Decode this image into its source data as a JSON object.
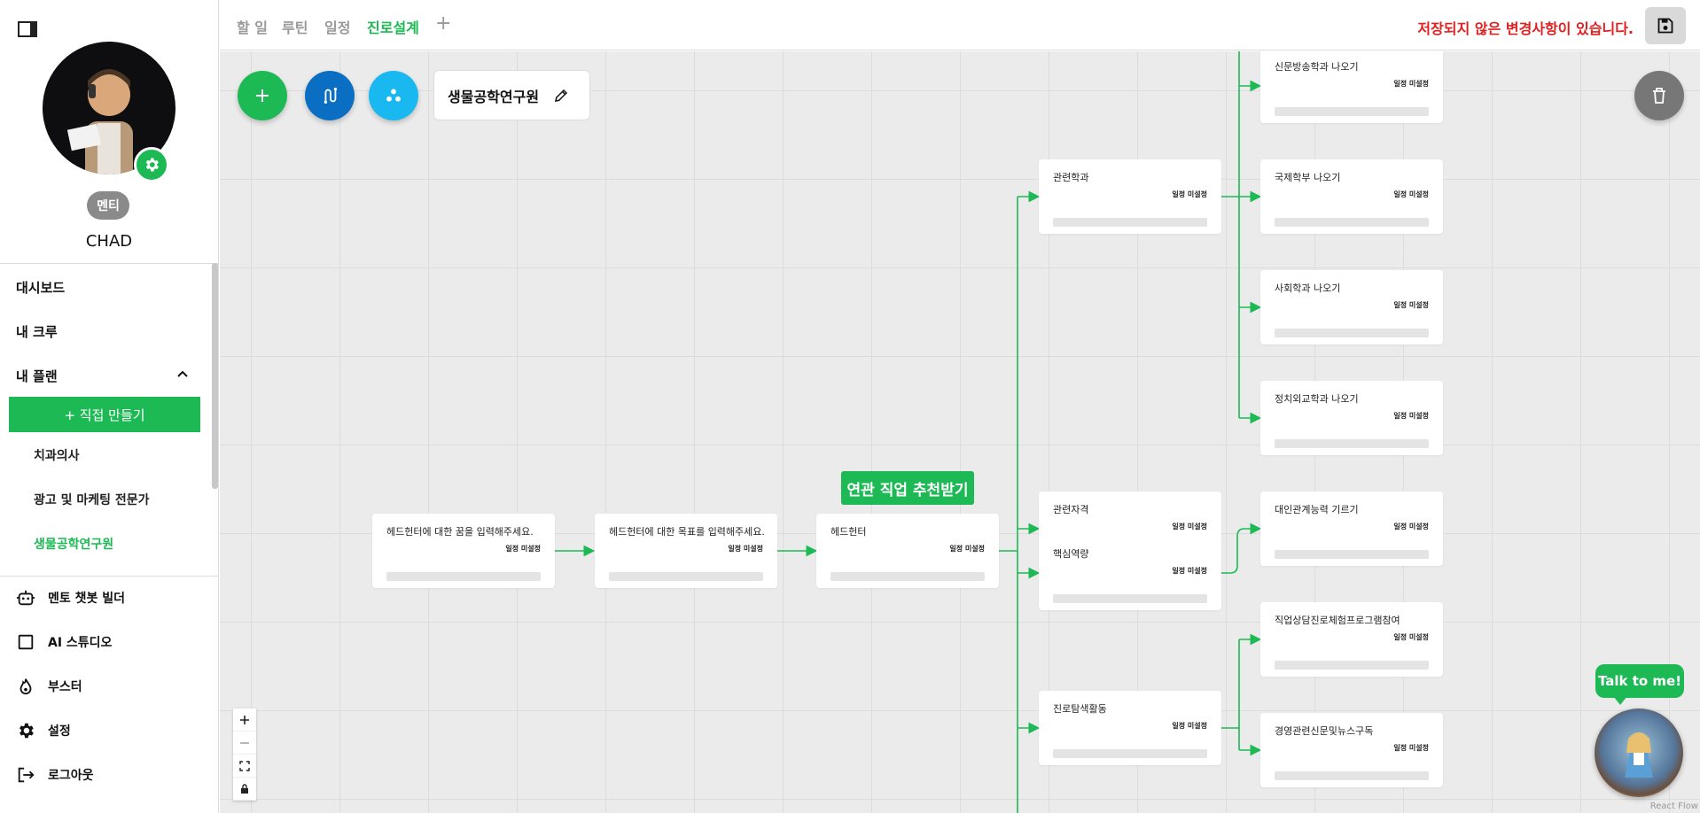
{
  "sidebar": {
    "role_badge": "멘티",
    "user_name": "CHAD",
    "menu": {
      "dashboard": "대시보드",
      "my_crew": "내 크루",
      "my_plan": "내 플랜"
    },
    "create_button": "+ 직접 만들기",
    "plans": [
      "치과의사",
      "광고 및 마케팅 전문가",
      "생물공학연구원"
    ],
    "active_plan": "생물공학연구원",
    "tools": {
      "mentor_bot": "멘토 챗봇 빌더",
      "ai_studio": "AI 스튜디오",
      "booster": "부스터",
      "settings": "설정",
      "logout": "로그아웃"
    }
  },
  "header": {
    "tabs": [
      "할 일",
      "루틴",
      "일정",
      "진로설계"
    ],
    "active_tab": "진로설계",
    "add_tab": "+",
    "unsaved_message": "저장되지 않은 변경사항이 있습니다."
  },
  "canvas": {
    "plan_title": "생물공학연구원",
    "schedule_label": "일정 미설정",
    "recommend_button": "연관 직업 추천받기",
    "nodes": {
      "dream": "헤드헌터에 대한 꿈을 입력해주세요.",
      "goal": "헤드헌터에 대한 목표를 입력해주세요.",
      "job": "헤드헌터",
      "related_major": "관련학과",
      "related_cert": "관련자격",
      "core_competency": "핵심역량",
      "career_exploration": "진로탐색활동",
      "journalism": "신문방송학과 나오기",
      "international": "국제학부 나오기",
      "sociology": "사회학과 나오기",
      "politics": "정치외교학과 나오기",
      "interpersonal": "대인관계능력 기르기",
      "counseling_program": "직업상담진로체험프로그램참여",
      "business_news": "경영관련신문및뉴스구독"
    },
    "chatbot_label": "Talk to me!",
    "attribution": "React Flow"
  },
  "colors": {
    "accent": "#1db954",
    "blue_fab": "#0a6fc2",
    "cyan_fab": "#19b8f0",
    "warning": "#e02020"
  }
}
